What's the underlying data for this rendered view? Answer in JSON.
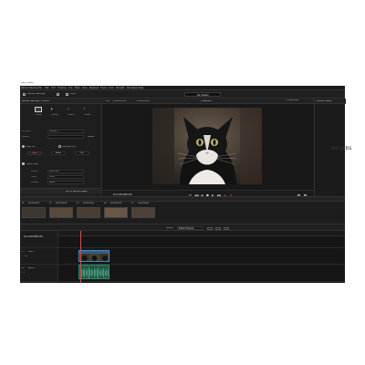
{
  "os_title": "cat_Project",
  "menu": [
    "DaVinci Resolve",
    "File",
    "Edit",
    "Trim",
    "Timeline",
    "Clip",
    "Mark",
    "View",
    "Playback",
    "Fusion",
    "Color",
    "Fairlight",
    "Workspace",
    "Help"
  ],
  "header": {
    "render_settings": "Render Settings",
    "clips": "Clips",
    "project_title": "cat_Project"
  },
  "left_panel": {
    "title": "Render Settings - Custom",
    "presets": [
      "Custom",
      "YouTube",
      "Vimeo",
      "Twitter"
    ],
    "presets_sub": [
      "",
      "1080p",
      "1080p",
      "1080p"
    ],
    "filename_label": "File name",
    "filename_value": "Timeline 1",
    "location_label": "Location",
    "location_value": "",
    "browse_label": "Browse",
    "render_single": "Single clip",
    "render_individual": "Individual clips",
    "tabs": [
      "Video",
      "Audio",
      "File"
    ],
    "export_video": "Export Video",
    "format_label": "Format",
    "format_value": "QuickTime",
    "codec_label": "Codec",
    "codec_value": "H.264",
    "encoder_label": "Encoder",
    "encoder_value": "Native",
    "add_to_queue": "Add to Render Queue"
  },
  "viewer": {
    "fit_label": "Fit",
    "source_tc": "01:00:00:00",
    "in_tc": "01:00:00:00",
    "zoom_label": "79%",
    "timeline_name": "Timeline 1",
    "right_tc": "11:43:10:00",
    "duration_label": "Global Enter",
    "duration_tc": "00:00:03:10",
    "transport_tc": "01:00:00:00",
    "transport_controls": [
      "⏮",
      "◀◀",
      "◀",
      "■",
      "▶",
      "▶▶",
      "⏭",
      "⟳"
    ]
  },
  "render_queue": {
    "title": "Render Queue",
    "empty_text": "No jobs"
  },
  "thumbs": [
    {
      "num": "01",
      "tc": "00:00:00:00",
      "label": "Stock Image Shot"
    },
    {
      "num": "02",
      "tc": "00:00:00:00",
      "label": "Stock image 2026"
    },
    {
      "num": "03",
      "tc": "00:00:00:00",
      "label": "Stock image 2029"
    },
    {
      "num": "04",
      "tc": "00:00:00:00",
      "label": "Stock image 2021"
    },
    {
      "num": "05",
      "tc": "00:00:00:00",
      "label": "Stock image 2010"
    }
  ],
  "timeline_bar": {
    "render_label": "Render",
    "range_label": "Entire Timeline"
  },
  "timeline": {
    "tc": "01:00:00:00",
    "tracks": [
      {
        "id": "V1",
        "name": "Video 1",
        "info": "1 Clip"
      },
      {
        "id": "A1",
        "name": "Audio 1",
        "info": "2.0"
      }
    ],
    "ruler_tc": "01:00:00:00"
  },
  "colors": {
    "playhead": "#ff3b3b",
    "video_clip": "#2f5f86",
    "audio_clip": "#1d5a47"
  }
}
